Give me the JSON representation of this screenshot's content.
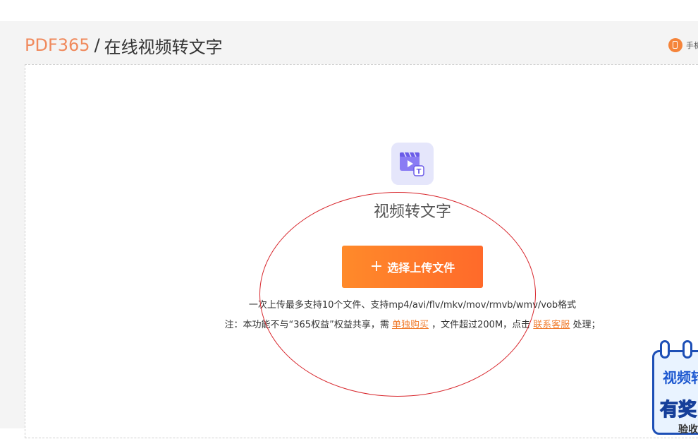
{
  "breadcrumb": {
    "brand": "PDF365",
    "separator": "/",
    "title": "在线视频转文字"
  },
  "header": {
    "phone_link_label": "手机"
  },
  "upload": {
    "tool_icon": "video-to-text-icon",
    "tool_title": "视频转文字",
    "button_icon": "plus-icon",
    "button_plus": "+",
    "button_label": "选择上传文件",
    "support_text": "一次上传最多支持10个文件、支持mp4/avi/flv/mkv/mov/rmvb/wmv/vob格式",
    "note": {
      "prefix": "注：本功能不与“365权益”权益共享，需",
      "buy_link": "单独购买",
      "middle": "，文件超过200M，点击",
      "service_link": "联系客服",
      "suffix": "处理；"
    }
  },
  "promo": {
    "title": "视频转",
    "subtitle": "有奖",
    "bottom": "验收"
  },
  "colors": {
    "brand_orange": "#f08a5d",
    "button_gradient_start": "#ff8a2a",
    "button_gradient_end": "#ff6a2a",
    "link_orange": "#f07a2a",
    "icon_bg": "#e5e6fb",
    "icon_purple": "#7a6cf0",
    "annotation_red": "#d8262c",
    "promo_blue": "#1d4fb6"
  }
}
